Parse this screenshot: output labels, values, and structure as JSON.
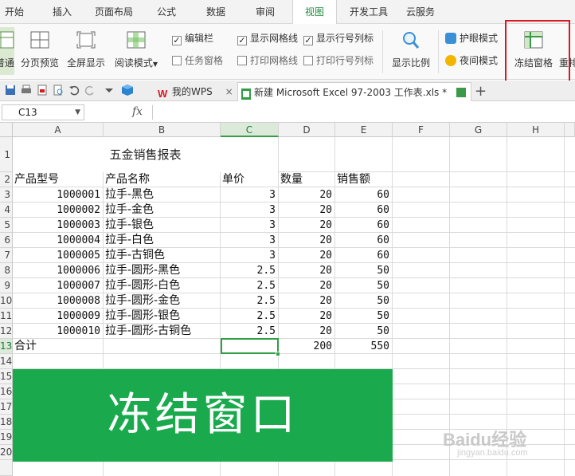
{
  "menu_tabs": [
    "开始",
    "插入",
    "页面布局",
    "公式",
    "数据",
    "审阅",
    "视图",
    "开发工具",
    "云服务"
  ],
  "active_tab": "视图",
  "ribbon": {
    "normal_label": "普通",
    "page_break_label": "分页预览",
    "fullscreen_label": "全屏显示",
    "read_mode_label": "阅读模式",
    "edit_bar_label": "编辑栏",
    "task_pane_label": "任务窗格",
    "show_gridlines_label": "显示网格线",
    "print_gridlines_label": "打印网格线",
    "show_headers_label": "显示行号列标",
    "print_headers_label": "打印行号列标",
    "zoom_label": "显示比例",
    "eye_mode_label": "护眼模式",
    "night_mode_label": "夜间模式",
    "freeze_label": "冻结窗格",
    "rearrange_label": "重排"
  },
  "quickbar": {
    "wps_tab": "我的WPS",
    "file_tab": "新建 Microsoft Excel 97-2003 工作表.xls *",
    "add": "+"
  },
  "formula_bar": {
    "name_box": "C13",
    "fx": "fx",
    "formula": ""
  },
  "columns": [
    "A",
    "B",
    "C",
    "D",
    "E",
    "F",
    "G",
    "H"
  ],
  "selected_column": "C",
  "row_numbers": [
    "1",
    "2",
    "3",
    "4",
    "5",
    "6",
    "7",
    "8",
    "9",
    "10",
    "11",
    "12",
    "13",
    "14",
    "15",
    "16",
    "17",
    "18",
    "19",
    "20"
  ],
  "selected_row": "13",
  "sheet": {
    "title": "五金销售报表",
    "headers": [
      "产品型号",
      "产品名称",
      "单价",
      "数量",
      "销售额"
    ],
    "rows": [
      [
        "1000001",
        "拉手-黑色",
        "3",
        "20",
        "60"
      ],
      [
        "1000002",
        "拉手-金色",
        "3",
        "20",
        "60"
      ],
      [
        "1000003",
        "拉手-银色",
        "3",
        "20",
        "60"
      ],
      [
        "1000004",
        "拉手-白色",
        "3",
        "20",
        "60"
      ],
      [
        "1000005",
        "拉手-古铜色",
        "3",
        "20",
        "60"
      ],
      [
        "1000006",
        "拉手-圆形-黑色",
        "2.5",
        "20",
        "50"
      ],
      [
        "1000007",
        "拉手-圆形-白色",
        "2.5",
        "20",
        "50"
      ],
      [
        "1000008",
        "拉手-圆形-金色",
        "2.5",
        "20",
        "50"
      ],
      [
        "1000009",
        "拉手-圆形-银色",
        "2.5",
        "20",
        "50"
      ],
      [
        "1000010",
        "拉手-圆形-古铜色",
        "2.5",
        "20",
        "50"
      ]
    ],
    "total_label": "合计",
    "total_qty": "200",
    "total_sales": "550"
  },
  "banner_text": "冻结窗口",
  "watermark": "Baidu经验",
  "watermark_sub": "jingyan.baidu.com",
  "colors": {
    "accent": "#1e8a3f",
    "banner": "#1aaa4d",
    "highlight": "#d8171f"
  }
}
